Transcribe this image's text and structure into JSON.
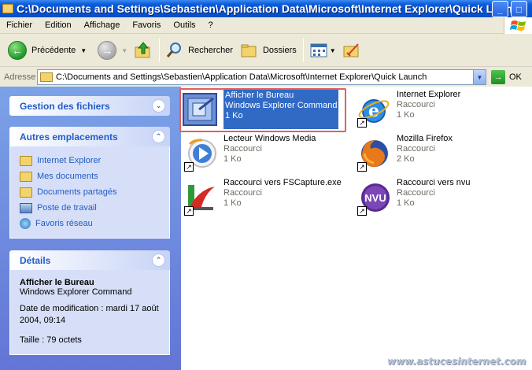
{
  "window": {
    "title": "C:\\Documents and Settings\\Sebastien\\Application Data\\Microsoft\\Internet Explorer\\Quick Launch",
    "minimize": "_",
    "maximize": "□"
  },
  "menu": [
    "Fichier",
    "Edition",
    "Affichage",
    "Favoris",
    "Outils",
    "?"
  ],
  "toolbar": {
    "back": "Précédente",
    "search": "Rechercher",
    "folders": "Dossiers"
  },
  "address": {
    "label": "Adresse",
    "value": "C:\\Documents and Settings\\Sebastien\\Application Data\\Microsoft\\Internet Explorer\\Quick Launch",
    "go": "OK"
  },
  "sidebar": {
    "file_tasks": {
      "title": "Gestion des fichiers"
    },
    "other_places": {
      "title": "Autres emplacements",
      "items": [
        {
          "label": "Internet Explorer",
          "icon": "internet-explorer-icon"
        },
        {
          "label": "Mes documents",
          "icon": "folder-icon"
        },
        {
          "label": "Documents partagés",
          "icon": "folder-icon"
        },
        {
          "label": "Poste de travail",
          "icon": "computer-icon"
        },
        {
          "label": "Favoris réseau",
          "icon": "network-icon"
        }
      ]
    },
    "details": {
      "title": "Détails",
      "name": "Afficher le Bureau",
      "type": "Windows Explorer Command",
      "modified_line1": "Date de modification : mardi 17 août",
      "modified_line2": "2004, 09:14",
      "size": "Taille : 79 octets"
    }
  },
  "files": [
    {
      "name": "Afficher le Bureau",
      "sub1": "Windows Explorer Command",
      "sub2": "1 Ko",
      "icon": "show-desktop-icon",
      "selected": true
    },
    {
      "name": "Internet Explorer",
      "sub1": "Raccourci",
      "sub2": "1 Ko",
      "icon": "internet-explorer-icon"
    },
    {
      "name": "Lecteur Windows Media",
      "sub1": "Raccourci",
      "sub2": "1 Ko",
      "icon": "windows-media-player-icon"
    },
    {
      "name": "Mozilla Firefox",
      "sub1": "Raccourci",
      "sub2": "2 Ko",
      "icon": "firefox-icon"
    },
    {
      "name": "Raccourci vers FSCapture.exe",
      "sub1": "Raccourci",
      "sub2": "1 Ko",
      "icon": "fscapture-icon"
    },
    {
      "name": "Raccourci vers nvu",
      "sub1": "Raccourci",
      "sub2": "1 Ko",
      "icon": "nvu-icon"
    }
  ],
  "watermark": "www.astucesinternet.com"
}
